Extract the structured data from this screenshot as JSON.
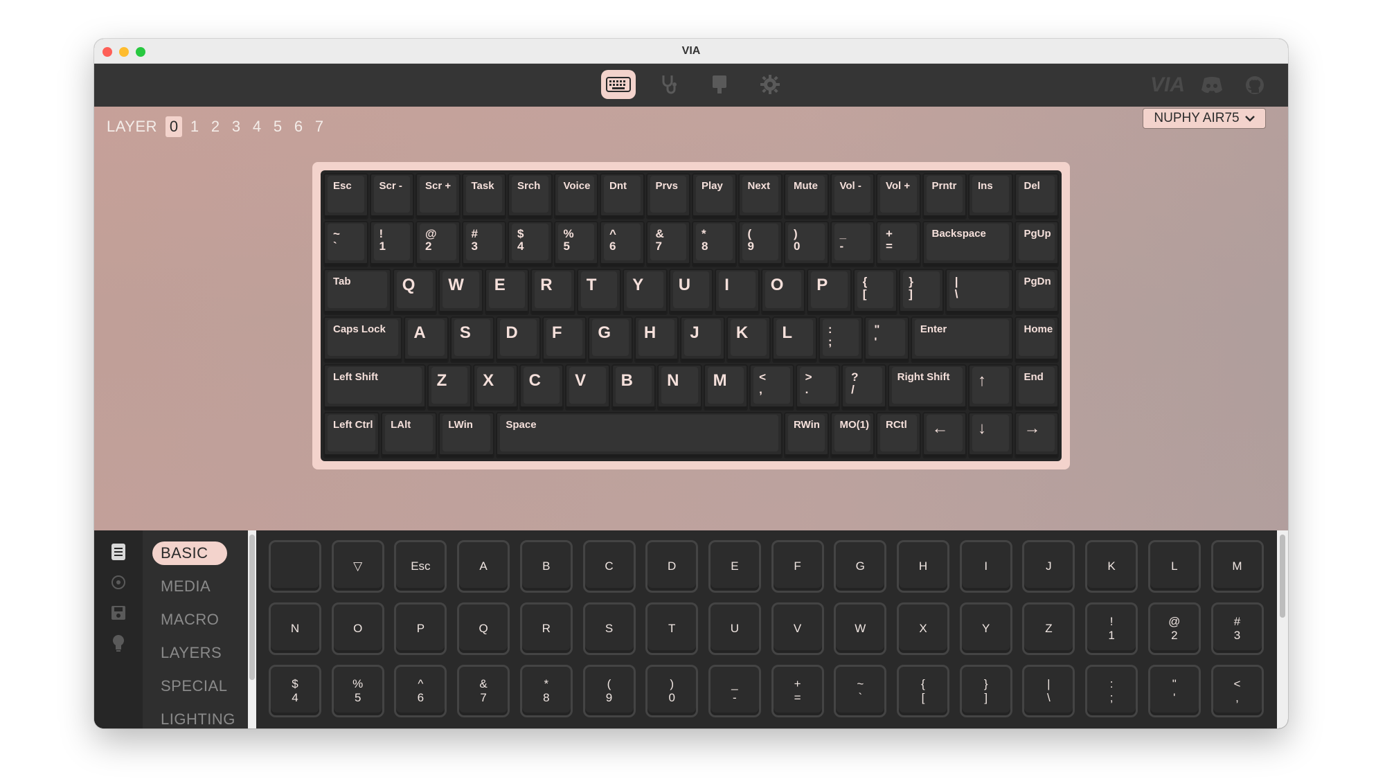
{
  "window": {
    "title": "VIA"
  },
  "toolbar": {
    "icons": [
      "keyboard-icon",
      "stethoscope-icon",
      "keycap-icon",
      "gear-icon"
    ],
    "right_icons": [
      "via-logo",
      "discord-icon",
      "github-icon"
    ],
    "via_logo_text": "VIA"
  },
  "layers": {
    "label": "LAYER",
    "items": [
      "0",
      "1",
      "2",
      "3",
      "4",
      "5",
      "6",
      "7"
    ],
    "active": "0"
  },
  "device": {
    "name": "NUPHY AIR75"
  },
  "keyboard": {
    "rows": [
      [
        [
          "Esc"
        ],
        [
          "Scr -"
        ],
        [
          "Scr +"
        ],
        [
          "Task"
        ],
        [
          "Srch"
        ],
        [
          "Voice"
        ],
        [
          "Dnt"
        ],
        [
          "Prvs"
        ],
        [
          "Play"
        ],
        [
          "Next"
        ],
        [
          "Mute"
        ],
        [
          "Vol -"
        ],
        [
          "Vol +"
        ],
        [
          "Prntr"
        ],
        [
          "Ins"
        ],
        [
          "Del"
        ]
      ],
      [
        [
          "~",
          "`"
        ],
        [
          "!",
          "1"
        ],
        [
          "@",
          "2"
        ],
        [
          "#",
          "3"
        ],
        [
          "$",
          "4"
        ],
        [
          "%",
          "5"
        ],
        [
          "^",
          "6"
        ],
        [
          "&",
          "7"
        ],
        [
          "*",
          "8"
        ],
        [
          "(",
          "9"
        ],
        [
          ")",
          "0"
        ],
        [
          "_",
          "-"
        ],
        [
          "+",
          "="
        ],
        [
          "Backspace"
        ],
        [
          "PgUp"
        ]
      ],
      [
        [
          "Tab"
        ],
        [
          "Q"
        ],
        [
          "W"
        ],
        [
          "E"
        ],
        [
          "R"
        ],
        [
          "T"
        ],
        [
          "Y"
        ],
        [
          "U"
        ],
        [
          "I"
        ],
        [
          "O"
        ],
        [
          "P"
        ],
        [
          "{",
          "["
        ],
        [
          "}",
          "]"
        ],
        [
          "|",
          "\\"
        ],
        [
          "PgDn"
        ]
      ],
      [
        [
          "Caps Lock"
        ],
        [
          "A"
        ],
        [
          "S"
        ],
        [
          "D"
        ],
        [
          "F"
        ],
        [
          "G"
        ],
        [
          "H"
        ],
        [
          "J"
        ],
        [
          "K"
        ],
        [
          "L"
        ],
        [
          ":",
          ";"
        ],
        [
          "\"",
          "'"
        ],
        [
          "Enter"
        ],
        [
          "Home"
        ]
      ],
      [
        [
          "Left Shift"
        ],
        [
          "Z"
        ],
        [
          "X"
        ],
        [
          "C"
        ],
        [
          "V"
        ],
        [
          "B"
        ],
        [
          "N"
        ],
        [
          "M"
        ],
        [
          "<",
          ","
        ],
        [
          ">",
          "."
        ],
        [
          "?",
          "/"
        ],
        [
          "Right Shift"
        ],
        [
          "↑"
        ],
        [
          "End"
        ]
      ],
      [
        [
          "Left Ctrl"
        ],
        [
          "LAlt"
        ],
        [
          "LWin"
        ],
        [
          "Space"
        ],
        [
          "RWin"
        ],
        [
          "MO(1)"
        ],
        [
          "RCtl"
        ],
        [
          "←"
        ],
        [
          "↓"
        ],
        [
          "→"
        ]
      ]
    ]
  },
  "sidebar": {
    "icons": [
      "document-icon",
      "circle-icon",
      "save-icon",
      "lightbulb-icon"
    ],
    "menu": [
      "BASIC",
      "MEDIA",
      "MACRO",
      "LAYERS",
      "SPECIAL",
      "LIGHTING"
    ],
    "active": "BASIC"
  },
  "picker": {
    "keys": [
      [
        ""
      ],
      [
        "▽"
      ],
      [
        "Esc"
      ],
      [
        "A"
      ],
      [
        "B"
      ],
      [
        "C"
      ],
      [
        "D"
      ],
      [
        "E"
      ],
      [
        "F"
      ],
      [
        "G"
      ],
      [
        "H"
      ],
      [
        "I"
      ],
      [
        "J"
      ],
      [
        "K"
      ],
      [
        "L"
      ],
      [
        "M"
      ],
      [
        "N"
      ],
      [
        "O"
      ],
      [
        "P"
      ],
      [
        "Q"
      ],
      [
        "R"
      ],
      [
        "S"
      ],
      [
        "T"
      ],
      [
        "U"
      ],
      [
        "V"
      ],
      [
        "W"
      ],
      [
        "X"
      ],
      [
        "Y"
      ],
      [
        "Z"
      ],
      [
        "!",
        "1"
      ],
      [
        "@",
        "2"
      ],
      [
        "#",
        "3"
      ],
      [
        "$",
        "4"
      ],
      [
        "%",
        "5"
      ],
      [
        "^",
        "6"
      ],
      [
        "&",
        "7"
      ],
      [
        "*",
        "8"
      ],
      [
        "(",
        "9"
      ],
      [
        ")",
        "0"
      ],
      [
        "_",
        "-"
      ],
      [
        "+",
        "="
      ],
      [
        "~",
        "`"
      ],
      [
        "{",
        "["
      ],
      [
        "}",
        "]"
      ],
      [
        "|",
        "\\"
      ],
      [
        ":",
        ";"
      ],
      [
        "\"",
        "'"
      ],
      [
        "<",
        ","
      ]
    ]
  },
  "colors": {
    "accent": "#f3d3cc",
    "dark": "#2a2a2a"
  }
}
